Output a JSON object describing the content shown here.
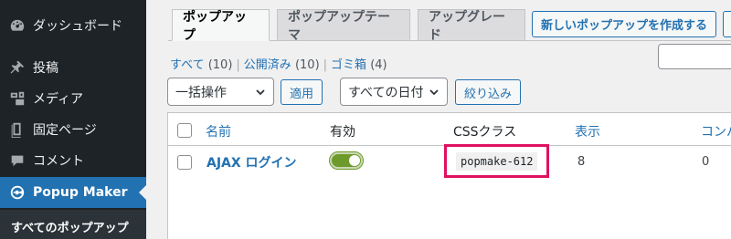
{
  "sidebar": {
    "items": [
      {
        "label": "ダッシュボード",
        "icon": "dashboard-icon"
      },
      {
        "label": "投稿",
        "icon": "pushpin-icon"
      },
      {
        "label": "メディア",
        "icon": "media-icon"
      },
      {
        "label": "固定ページ",
        "icon": "page-icon"
      },
      {
        "label": "コメント",
        "icon": "comment-icon"
      },
      {
        "label": "Popup Maker",
        "icon": "popup-maker-icon"
      }
    ],
    "submenu_current": "すべてのポップアップ"
  },
  "tabs": [
    {
      "label": "ポップアップ",
      "active": true
    },
    {
      "label": "ポップアップテーマ",
      "active": false
    },
    {
      "label": "アップグレード",
      "active": false
    }
  ],
  "add_new_button": "新しいポップアップを作成する",
  "status_filters": [
    {
      "label": "すべて",
      "count": "(10)"
    },
    {
      "label": "公開済み",
      "count": "(10)"
    },
    {
      "label": "ゴミ箱",
      "count": "(4)"
    }
  ],
  "filters": {
    "bulk_action": "一括操作",
    "apply": "適用",
    "date_filter": "すべての日付",
    "filter_button": "絞り込み"
  },
  "table": {
    "columns": [
      "名前",
      "有効",
      "CSSクラス",
      "表示",
      "コンバ"
    ],
    "rows": [
      {
        "name": "AJAX ログイン",
        "enabled": true,
        "css_class": "popmake-612",
        "views": "8",
        "conversions": "0"
      }
    ]
  },
  "colors": {
    "sidebar_bg": "#1d2327",
    "active_menu": "#2271b1",
    "link": "#2271b1",
    "toggle_on": "#6e9a2c",
    "highlight": "#e0115f"
  }
}
